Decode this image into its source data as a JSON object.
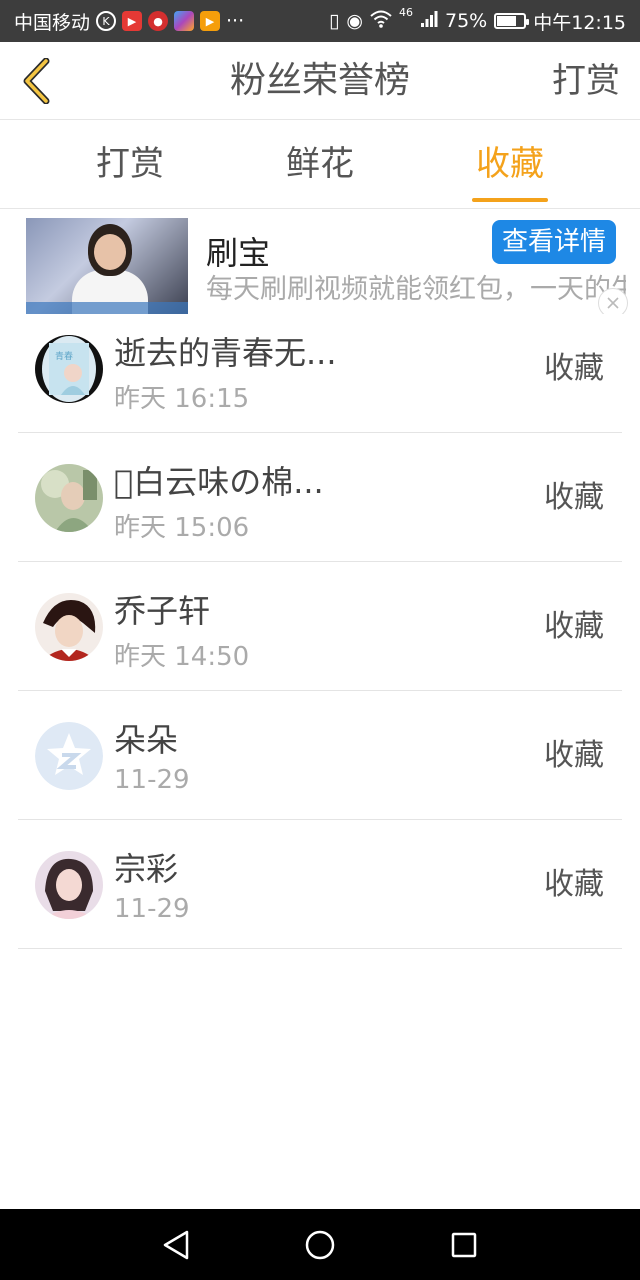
{
  "status_bar": {
    "carrier": "中国移动",
    "more": "···",
    "network": "46",
    "battery": "75%",
    "battery_level": 0.75,
    "time": "中午12:15"
  },
  "header": {
    "title": "粉丝荣誉榜",
    "action": "打赏"
  },
  "tabs": [
    {
      "label": "打赏",
      "active": false
    },
    {
      "label": "鲜花",
      "active": false
    },
    {
      "label": "收藏",
      "active": true
    }
  ],
  "ad": {
    "title": "刷宝",
    "description": "每天刷刷视频就能领红包，一天的生活费就够了",
    "button": "查看详情"
  },
  "list": [
    {
      "name": "逝去的青春无...",
      "time": "昨天 16:15",
      "action": "收藏"
    },
    {
      "name": "􏰀白云味の棉...",
      "time": "昨天 15:06",
      "action": "收藏"
    },
    {
      "name": "乔子轩",
      "time": "昨天 14:50",
      "action": "收藏"
    },
    {
      "name": "朵朵",
      "time": "11-29",
      "action": "收藏"
    },
    {
      "name": "宗彩",
      "time": "11-29",
      "action": "收藏"
    }
  ],
  "colors": {
    "accent": "#f4a21b",
    "ad_button": "#1e88e5",
    "status_bar": "#3d3d3d"
  }
}
